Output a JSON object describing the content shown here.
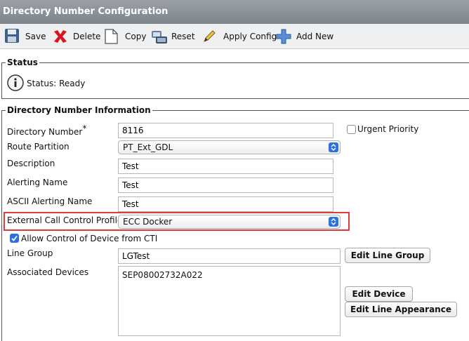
{
  "window": {
    "title": "Directory Number Configuration"
  },
  "toolbar": {
    "save": "Save",
    "delete": "Delete",
    "copy": "Copy",
    "reset": "Reset",
    "apply_config": "Apply Config",
    "add_new": "Add New"
  },
  "status": {
    "section_title": "Status",
    "text": "Status: Ready"
  },
  "dn_info": {
    "section_title": "Directory Number Information",
    "directory_number_label": "Directory Number",
    "required_marker": "*",
    "directory_number_value": "8116",
    "urgent_priority_label": "Urgent Priority",
    "urgent_priority_checked": false,
    "route_partition_label": "Route Partition",
    "route_partition_value": "PT_Ext_GDL",
    "description_label": "Description",
    "description_value": "Test",
    "alerting_name_label": "Alerting Name",
    "alerting_name_value": "Test",
    "ascii_alerting_name_label": "ASCII Alerting Name",
    "ascii_alerting_name_value": "Test",
    "ecc_profile_label": "External Call Control Profile",
    "ecc_profile_value": "ECC Docker",
    "allow_cti_label": "Allow Control of Device from CTI",
    "allow_cti_checked": true,
    "line_group_label": "Line Group",
    "line_group_value": "LGTest",
    "edit_line_group": "Edit Line Group",
    "associated_devices_label": "Associated Devices",
    "associated_devices": [
      "SEP08002732A022"
    ],
    "edit_device": "Edit Device",
    "edit_line_appearance": "Edit Line Appearance"
  },
  "colors": {
    "accent": "#2b72e0",
    "highlight": "#e03b3b",
    "titlebar": "#8a9096"
  }
}
